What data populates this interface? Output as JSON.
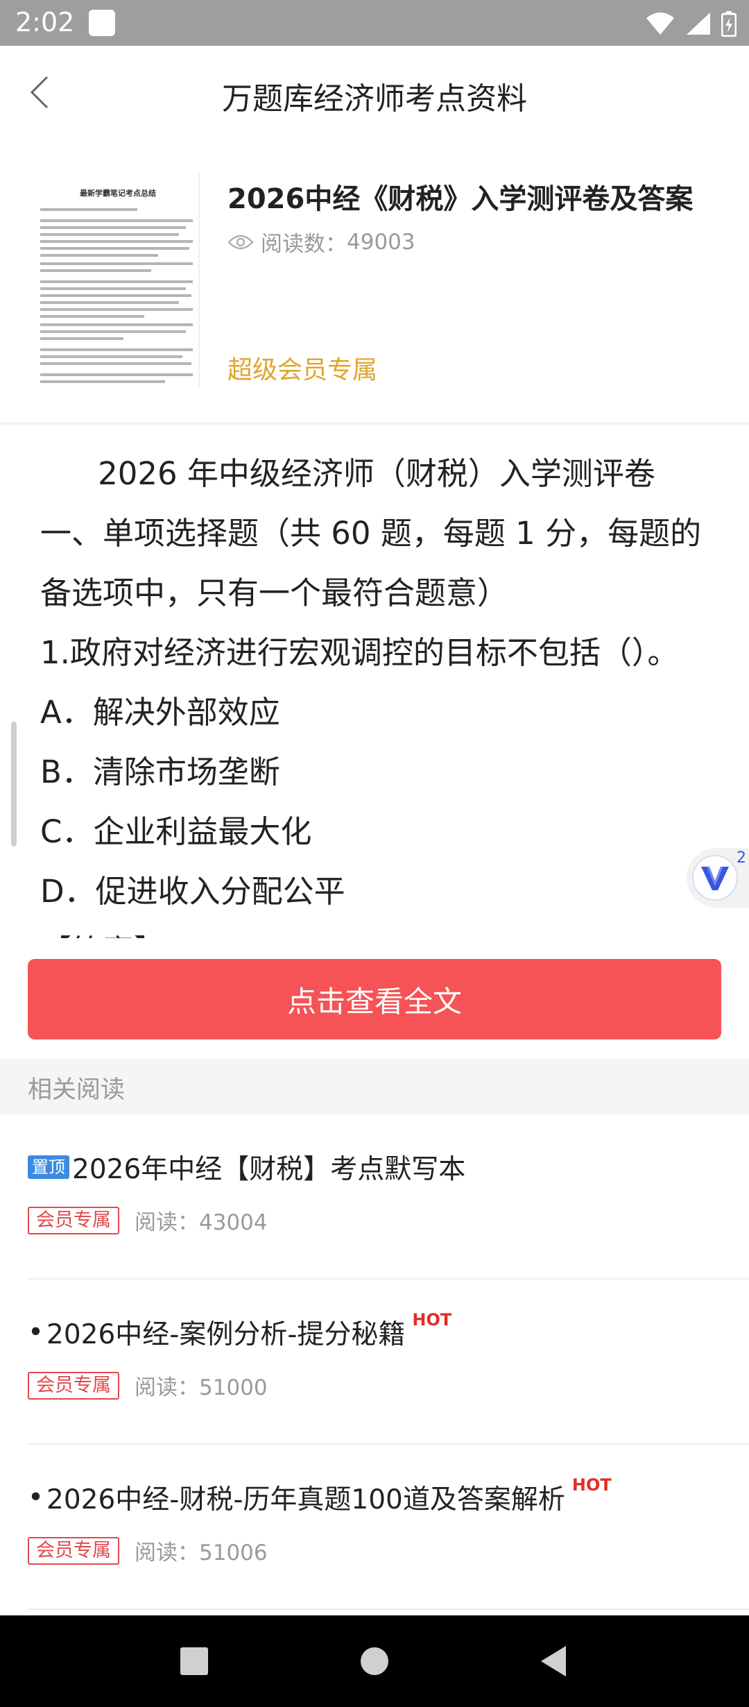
{
  "status_bar": {
    "time": "2:02",
    "icons": [
      "notification-icon",
      "wifi-icon",
      "signal-icon",
      "battery-charging-icon"
    ]
  },
  "app_bar": {
    "title": "万题库经济师考点资料",
    "back_icon": "back-chevron-icon"
  },
  "document": {
    "title": "2026中经《财税》入学测评卷及答案",
    "reads_label": "阅读数：",
    "reads_count": "49003",
    "vip_label": "超级会员专属",
    "thumbnail_heading": "最新学霸笔记考点总结"
  },
  "preview": {
    "lines": [
      "2026 年中级经济师（财税）入学测评卷",
      "一、单项选择题（共 60 题，每题 1 分，每题的",
      "备选项中，只有一个最符合题意）",
      "1.政府对经济进行宏观调控的目标不包括（）。",
      "A．解决外部效应",
      "B．清除市场垄断",
      "C．企业利益最大化",
      "D．促进收入分配公平",
      "【答案】C"
    ]
  },
  "float_badge": {
    "count": "2",
    "icon": "v-logo-icon"
  },
  "view_full_button": "点击查看全文",
  "related": {
    "header": "相关阅读",
    "items": [
      {
        "pin_label": "置顶",
        "bullet": "",
        "title": "2026年中经【财税】考点默写本",
        "hot": "",
        "member_label": "会员专属",
        "reads": "阅读：43004"
      },
      {
        "pin_label": "",
        "bullet": "•",
        "title": "2026中经-案例分析-提分秘籍",
        "hot": "HOT",
        "member_label": "会员专属",
        "reads": "阅读：51000"
      },
      {
        "pin_label": "",
        "bullet": "•",
        "title": "2026中经-财税-历年真题100道及答案解析",
        "hot": "HOT",
        "member_label": "会员专属",
        "reads": "阅读：51006"
      }
    ]
  },
  "nav_bar": {
    "icons": [
      "recents-square-icon",
      "home-circle-icon",
      "back-triangle-icon"
    ]
  },
  "colors": {
    "status_bar": "#9e9e9e",
    "vip_gold": "#e0a52c",
    "primary_red": "#f65357",
    "member_red": "#e0484c",
    "hot_red": "#e22f26",
    "pin_blue": "#3d8be0"
  }
}
